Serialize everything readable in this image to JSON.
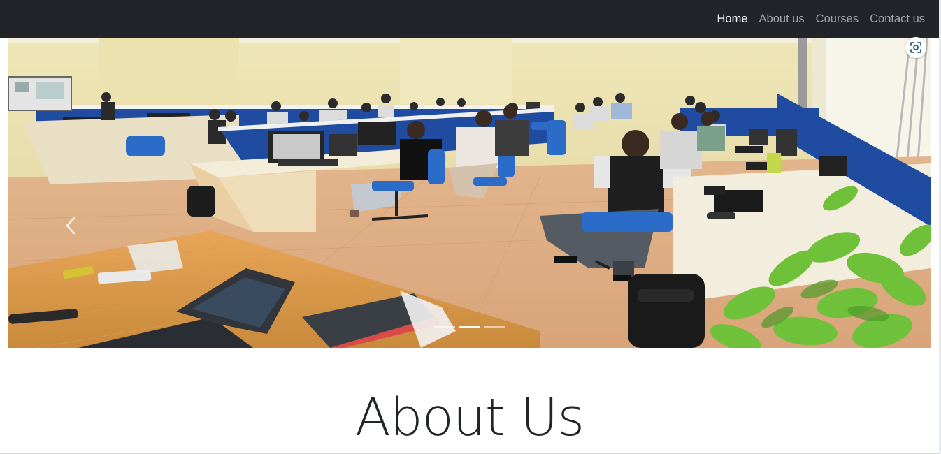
{
  "navbar": {
    "links": [
      {
        "label": "Home",
        "active": true
      },
      {
        "label": "About us",
        "active": false
      },
      {
        "label": "Courses",
        "active": false
      },
      {
        "label": "Contact us",
        "active": false
      }
    ]
  },
  "carousel": {
    "slide_count": 3,
    "active_slide": 1,
    "image_description_icon": "classroom-photo",
    "prev_icon": "chevron-left-icon",
    "lens_icon": "visual-search-icon"
  },
  "about": {
    "heading": "About Us"
  },
  "colors": {
    "navbar_bg": "#212529",
    "nav_active": "#ffffff",
    "nav_inactive": "#a6a8aa",
    "heading": "#212529"
  }
}
